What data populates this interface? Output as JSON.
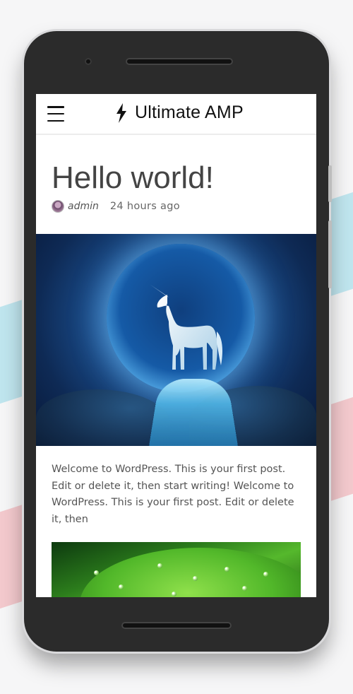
{
  "header": {
    "menu_icon": "hamburger-menu-icon",
    "brand_icon": "lightning-bolt-icon",
    "brand_title": "Ultimate AMP"
  },
  "post": {
    "title": "Hello world!",
    "author": "admin",
    "time": "24 hours ago",
    "featured_image": "unicorn-moon-image",
    "excerpt": "Welcome to WordPress. This is your first post. Edit or delete it, then start writing! Welcome to WordPress. This is your first post. Edit or delete it, then",
    "inline_image": "green-leaf-water-drops-image"
  },
  "colors": {
    "background": "#f6f6f7",
    "stripe_blue": "#bfe5ee",
    "stripe_pink": "#f3c9cd",
    "phone_body": "#2b2b2b",
    "title_text": "#444444",
    "body_text": "#555555"
  }
}
